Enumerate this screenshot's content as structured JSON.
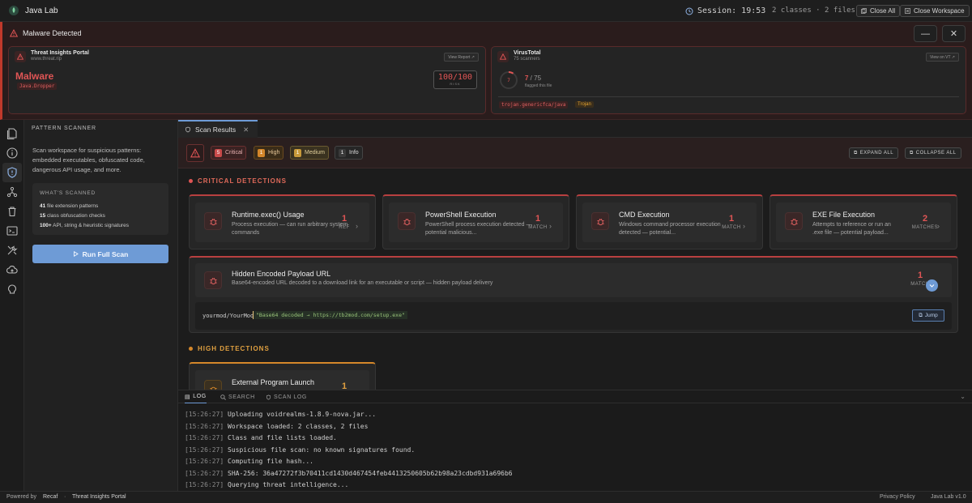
{
  "app": {
    "title": "Java Lab"
  },
  "titlebar": {
    "session_label": "Session: 19:53",
    "counts": "2 classes · 2 files",
    "close_all": "Close All",
    "close_workspace": "Close Workspace"
  },
  "banner": {
    "title": "Malware Detected",
    "minimize_symbol": "—",
    "close_symbol": "✕",
    "threat_portal": {
      "name": "Threat Insights Portal",
      "url": "www.threat.rip",
      "link": "View Report ↗",
      "verdict": "Malware",
      "family": "Java.Dropper",
      "risk_value": "100/100",
      "risk_label": "RISK"
    },
    "virustotal": {
      "name": "VirusTotal",
      "scanners": "75 scanners",
      "link": "View on VT ↗",
      "ring_value": "7",
      "detected": "7",
      "total": " / 75",
      "note": "flagged this file",
      "detected_fraction": 0.093,
      "tags": [
        "trojan.genericfca/java",
        "Trojan"
      ]
    }
  },
  "sidebar": {
    "heading": "PATTERN SCANNER",
    "description": "Scan workspace for suspicious patterns: embedded executables, obfuscated code, dangerous API usage, and more.",
    "box_title": "WHAT'S SCANNED",
    "items": [
      {
        "num": "41",
        "text": " file extension patterns"
      },
      {
        "num": "15",
        "text": " class obfuscation checks"
      },
      {
        "num": "100+",
        "text": " API, string & heuristic signatures"
      }
    ],
    "run_button": "Run Full Scan"
  },
  "activity_icons": [
    "files-icon",
    "info-icon",
    "shield-icon",
    "graph-icon",
    "trash-icon",
    "terminal-icon",
    "tools-icon",
    "cloud-upload-icon",
    "brain-icon"
  ],
  "main": {
    "tab_label": "Scan Results",
    "summary": {
      "critical": {
        "count": "5",
        "label": "Critical"
      },
      "high": {
        "count": "1",
        "label": "High"
      },
      "medium": {
        "count": "1",
        "label": "Medium"
      },
      "info": {
        "count": "1",
        "label": "Info"
      },
      "expand_all": "EXPAND ALL",
      "collapse_all": "COLLAPSE ALL"
    },
    "critical_heading": "CRITICAL DETECTIONS",
    "high_heading": "HIGH DETECTIONS",
    "critical_cards": [
      {
        "title": "Runtime.exec() Usage",
        "desc": "Process execution — can run arbitrary system commands",
        "count": "1",
        "count_label": "REF"
      },
      {
        "title": "PowerShell Execution",
        "desc": "PowerShell process execution detected — potential malicious...",
        "count": "1",
        "count_label": "MATCH"
      },
      {
        "title": "CMD Execution",
        "desc": "Windows command processor execution detected — potential...",
        "count": "1",
        "count_label": "MATCH"
      },
      {
        "title": "EXE File Execution",
        "desc": "Attempts to reference or run an .exe file — potential payload...",
        "count": "2",
        "count_label": "MATCHES"
      }
    ],
    "expanded_card": {
      "title": "Hidden Encoded Payload URL",
      "desc": "Base64-encoded URL decoded to a download link for an executable or script — hidden payload delivery",
      "count": "1",
      "count_label": "MATCH",
      "code_location": "yourmod/YourMod",
      "code_value": "\"Base64 decoded → https://tb2mod.com/setup.exe\"",
      "jump": "Jump"
    },
    "high_card": {
      "title": "External Program Launch",
      "count": "1"
    }
  },
  "log": {
    "tabs": [
      "LOG",
      "SEARCH",
      "SCAN LOG"
    ],
    "lines": [
      {
        "ts": "[15:26:27]",
        "msg": "Uploading voidrealms-1.8.9-nova.jar..."
      },
      {
        "ts": "[15:26:27]",
        "msg": "Workspace loaded: 2 classes, 2 files"
      },
      {
        "ts": "[15:26:27]",
        "msg": "Class and file lists loaded."
      },
      {
        "ts": "[15:26:27]",
        "msg": "Suspicious file scan: no known signatures found."
      },
      {
        "ts": "[15:26:27]",
        "msg": "Computing file hash..."
      },
      {
        "ts": "[15:26:27]",
        "msg": "SHA-256: 36a47272f3b70411cd1430d467454feb4413250605b62b98a23cdbd931a696b6"
      },
      {
        "ts": "[15:26:27]",
        "msg": "Querying threat intelligence..."
      }
    ]
  },
  "statusbar": {
    "powered_by": "Powered by",
    "recaf": "Recaf",
    "sep": "·",
    "portal": "Threat Insights Portal",
    "privacy": "Privacy Policy",
    "version": "Java Lab v1.0"
  },
  "colors": {
    "accent": "#6e9bd6",
    "critical": "#e05555",
    "high": "#d4872a",
    "medium": "#c89a3a"
  }
}
